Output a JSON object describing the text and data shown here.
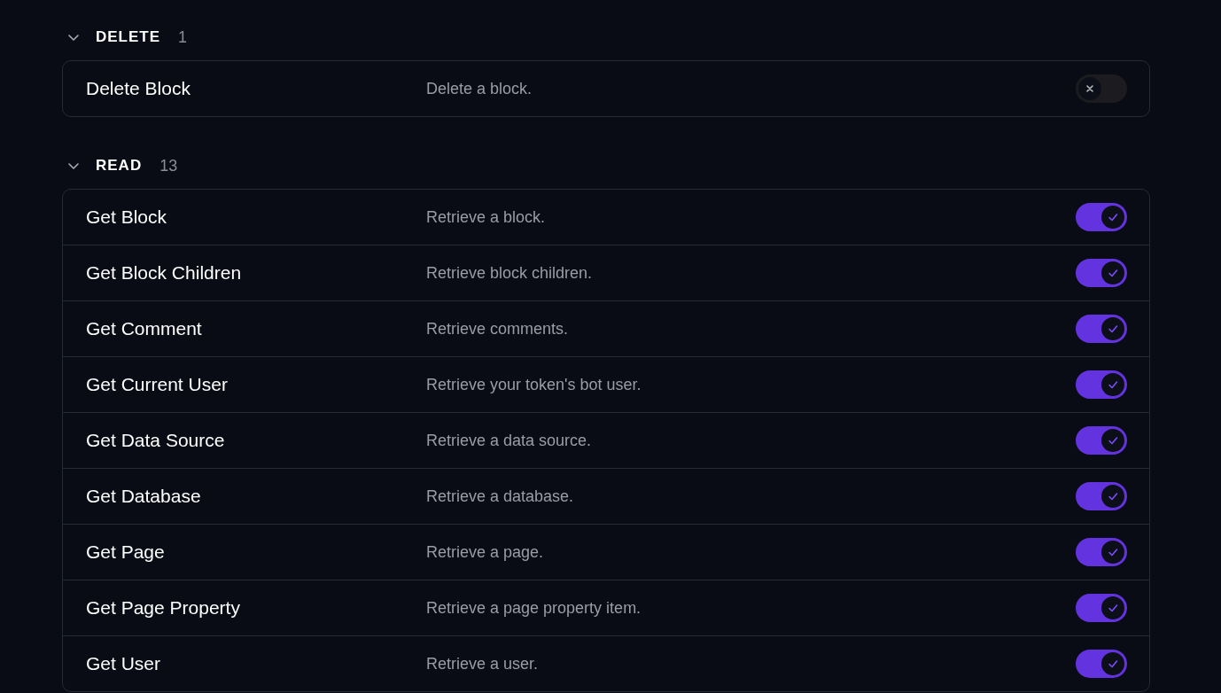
{
  "sections": [
    {
      "title": "DELETE",
      "count": "1",
      "expanded": true,
      "tools": [
        {
          "name": "Delete Block",
          "description": "Delete a block.",
          "on": false
        }
      ]
    },
    {
      "title": "READ",
      "count": "13",
      "expanded": true,
      "tools": [
        {
          "name": "Get Block",
          "description": "Retrieve a block.",
          "on": true
        },
        {
          "name": "Get Block Children",
          "description": "Retrieve block children.",
          "on": true
        },
        {
          "name": "Get Comment",
          "description": "Retrieve comments.",
          "on": true
        },
        {
          "name": "Get Current User",
          "description": "Retrieve your token's bot user.",
          "on": true
        },
        {
          "name": "Get Data Source",
          "description": "Retrieve a data source.",
          "on": true
        },
        {
          "name": "Get Database",
          "description": "Retrieve a database.",
          "on": true
        },
        {
          "name": "Get Page",
          "description": "Retrieve a page.",
          "on": true
        },
        {
          "name": "Get Page Property",
          "description": "Retrieve a page property item.",
          "on": true
        },
        {
          "name": "Get User",
          "description": "Retrieve a user.",
          "on": true
        }
      ]
    }
  ]
}
